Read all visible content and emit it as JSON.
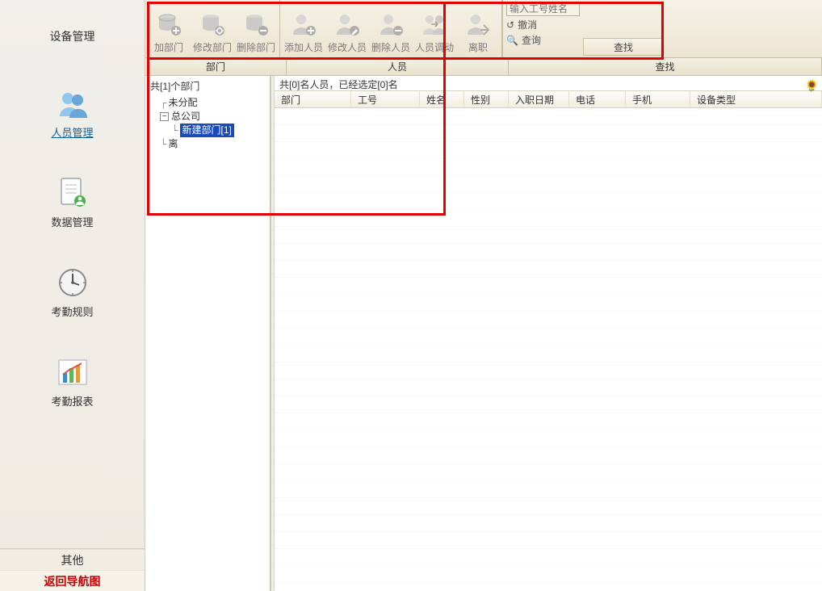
{
  "sidebar": {
    "header": "设备管理",
    "items": [
      {
        "label": "人员管理",
        "icon": "people-icon",
        "active": true
      },
      {
        "label": "数据管理",
        "icon": "document-icon",
        "active": false
      },
      {
        "label": "考勤规则",
        "icon": "clock-icon",
        "active": false
      },
      {
        "label": "考勤报表",
        "icon": "chart-icon",
        "active": false
      }
    ],
    "footer": {
      "other": "其他",
      "back": "返回导航图"
    }
  },
  "toolbar": {
    "dept_group": [
      {
        "label": "加部门",
        "icon": "db-add"
      },
      {
        "label": "修改部门",
        "icon": "db-edit"
      },
      {
        "label": "删除部门",
        "icon": "db-del"
      }
    ],
    "person_group": [
      {
        "label": "添加人员",
        "icon": "person-add"
      },
      {
        "label": "修改人员",
        "icon": "person-edit"
      },
      {
        "label": "删除人员",
        "icon": "person-del"
      },
      {
        "label": "人员调动",
        "icon": "person-move"
      },
      {
        "label": "离职",
        "icon": "person-leave"
      }
    ],
    "search": {
      "placeholder": "输入工号姓名",
      "cancel": "撤消",
      "query": "查询",
      "find": "查找"
    }
  },
  "tabs": {
    "dept": "部门",
    "person": "人员",
    "find": "查找"
  },
  "tree": {
    "caption": "共[1]个部门",
    "unassigned": "未分配",
    "root": "总公司",
    "new_dept": "新建部门[1]",
    "leave": "离"
  },
  "list": {
    "caption": "共[0]名人员，已经选定[0]名",
    "columns": [
      "部门",
      "工号",
      "姓名",
      "性别",
      "入职日期",
      "电话",
      "手机",
      "设备类型"
    ]
  }
}
